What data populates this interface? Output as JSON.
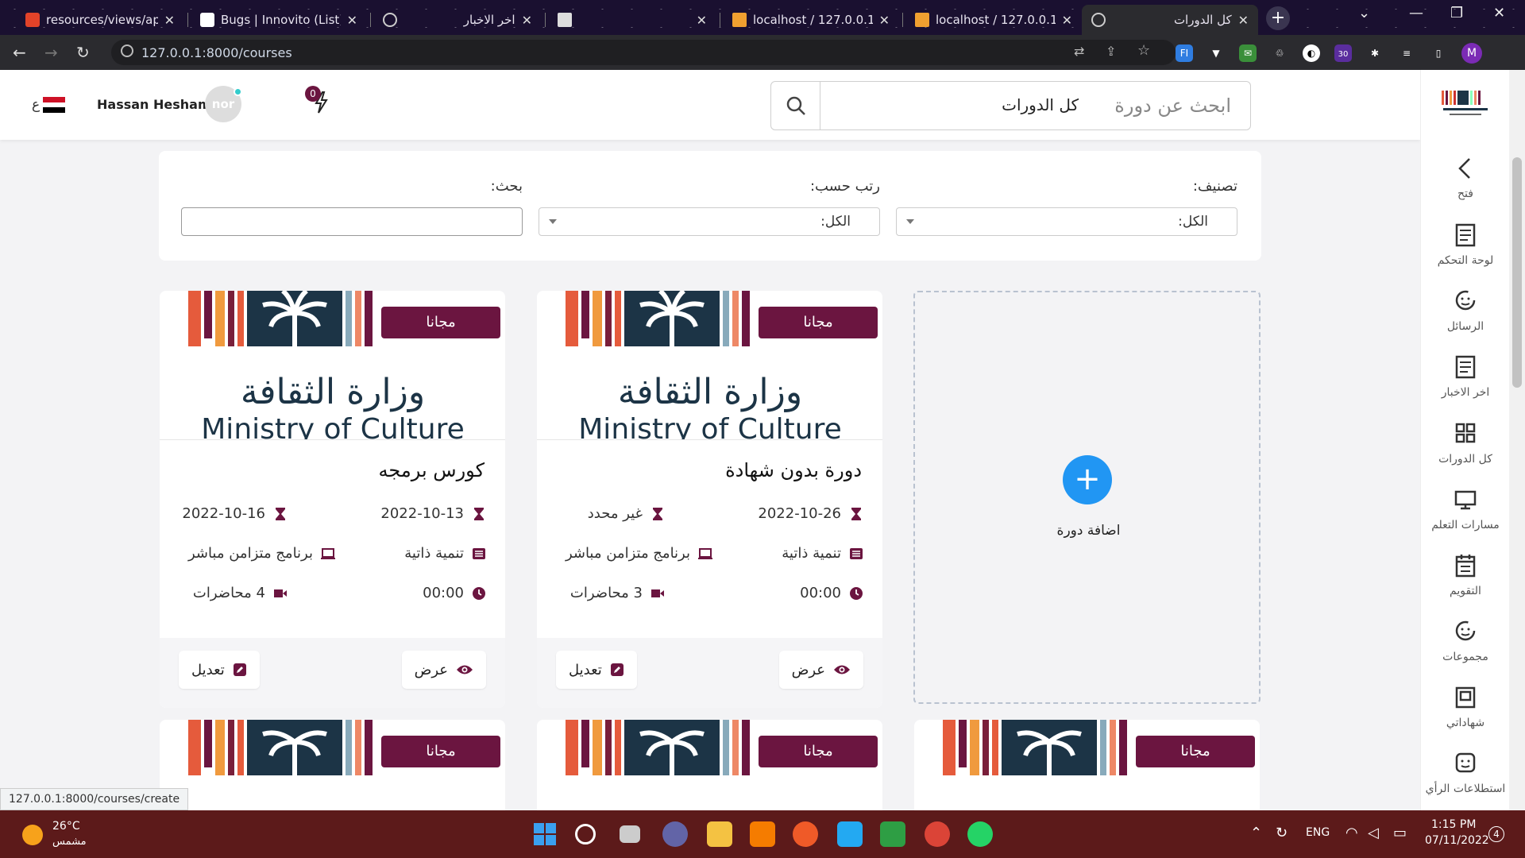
{
  "browser": {
    "tabs": [
      {
        "title": "resources/views/app/"
      },
      {
        "title": "Bugs | Innovito (List)"
      },
      {
        "title": "اخر الاخبار"
      },
      {
        "title": ""
      },
      {
        "title": "localhost / 127.0.0.1"
      },
      {
        "title": "localhost / 127.0.0.1"
      },
      {
        "title": "كل الدورات"
      }
    ],
    "url": "127.0.0.1:8000/courses",
    "ext_badge": "30",
    "profile_initial": "M",
    "status_url": "127.0.0.1:8000/courses/create"
  },
  "header": {
    "page_title": "كل الدورات",
    "search_placeholder": "ابحث عن دورة",
    "user_name": "Hassan Hesham",
    "avatar_text": "nor",
    "notif_count": "0",
    "lang": "ع"
  },
  "sidebar": {
    "items": [
      {
        "label": "فتح",
        "icon": "chevron-left-icon"
      },
      {
        "label": "لوحة التحكم",
        "icon": "dashboard-icon"
      },
      {
        "label": "الرسائل",
        "icon": "messages-icon"
      },
      {
        "label": "اخر الاخبار",
        "icon": "news-icon"
      },
      {
        "label": "كل الدورات",
        "icon": "grid-icon"
      },
      {
        "label": "مسارات التعلم",
        "icon": "monitor-icon"
      },
      {
        "label": "التقويم",
        "icon": "calendar-icon"
      },
      {
        "label": "مجموعات",
        "icon": "groups-icon"
      },
      {
        "label": "شهاداتي",
        "icon": "certificate-icon"
      },
      {
        "label": "استطلاعات الرأي",
        "icon": "survey-icon"
      }
    ]
  },
  "filters": {
    "category_label": "تصنيف:",
    "category_value": "الكل:",
    "sort_label": "رتب حسب:",
    "sort_value": "الكل:",
    "search_label": "بحث:"
  },
  "add_course": {
    "label": "اضافة دورة"
  },
  "cards": [
    {
      "badge": "مجانا",
      "title": "دورة بدون شهادة",
      "start_date": "2022-10-26",
      "end_date": "غير محدد",
      "category": "تنمية ذاتية",
      "type": "برنامج متزامن مباشر",
      "duration": "00:00",
      "lectures": "3 محاضرات",
      "view_label": "عرض",
      "edit_label": "تعديل"
    },
    {
      "badge": "مجانا",
      "title": "كورس برمجه",
      "start_date": "2022-10-13",
      "end_date": "2022-10-16",
      "category": "تنمية ذاتية",
      "type": "برنامج متزامن مباشر",
      "duration": "00:00",
      "lectures": "4 محاضرات",
      "view_label": "عرض",
      "edit_label": "تعديل"
    }
  ],
  "partial_cards": [
    {
      "badge": "مجانا"
    },
    {
      "badge": "مجانا"
    },
    {
      "badge": "مجانا"
    }
  ],
  "logo": {
    "arabic": "وزارة الثقافة",
    "english": "Ministry of Culture"
  },
  "taskbar": {
    "temp": "26°C",
    "weather": "مشمس",
    "lang": "ENG",
    "time": "1:15 PM",
    "date": "07/11/2022",
    "notif_count": "4"
  },
  "colors": {
    "accent": "#6b1540",
    "add_button": "#2196f3"
  }
}
